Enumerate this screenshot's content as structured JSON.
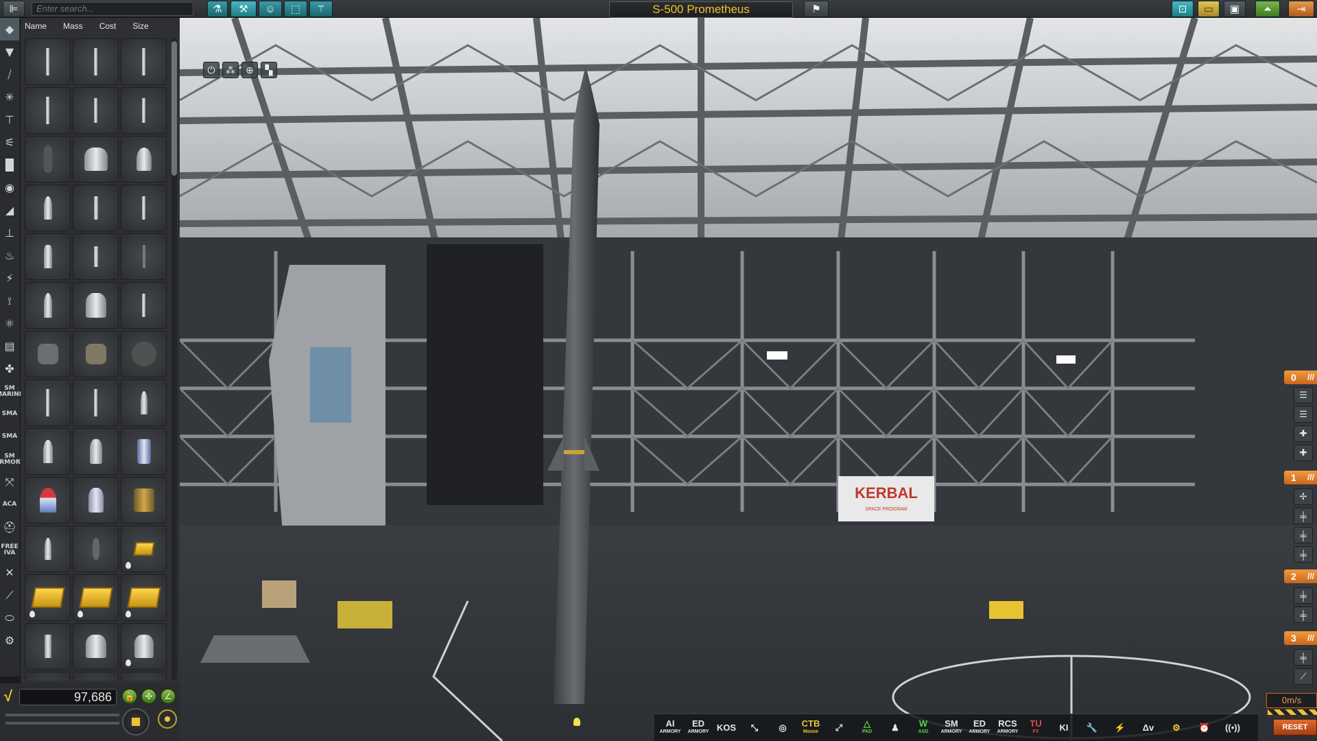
{
  "search": {
    "placeholder": "Enter search..."
  },
  "ship": {
    "name": "S-500 Prometheus"
  },
  "parts_panel": {
    "sort_headers": [
      "Name",
      "Mass",
      "Cost",
      "Size"
    ]
  },
  "funds": {
    "value": "97,686"
  },
  "category_labels": {
    "sm_marine": "SM\nMARINE",
    "sm_armory": "SM\nARMORY",
    "free_iva": "FREE\nIVA",
    "aca": "ACA"
  },
  "staging": {
    "stages": [
      "0",
      "1",
      "2",
      "3"
    ],
    "speed": "0m/s",
    "reset_label": "RESET"
  },
  "toolbar": {
    "items": [
      {
        "label": "AI",
        "sub": "ARMORY"
      },
      {
        "label": "ED",
        "sub": "ARMORY"
      },
      {
        "label": "KOS",
        "sub": ""
      },
      {
        "label": "⤡",
        "sub": ""
      },
      {
        "label": "◎",
        "sub": ""
      },
      {
        "label": "CTB",
        "sub": "Mouse"
      },
      {
        "label": "⤢",
        "sub": ""
      },
      {
        "label": "△",
        "sub": "PAD"
      },
      {
        "label": "♟",
        "sub": ""
      },
      {
        "label": "W",
        "sub": "ASD"
      },
      {
        "label": "SM",
        "sub": "ARMORY"
      },
      {
        "label": "ED",
        "sub": "ARMORY"
      },
      {
        "label": "RCS",
        "sub": "ARMORY"
      },
      {
        "label": "TU",
        "sub": "FX"
      },
      {
        "label": "KI",
        "sub": ""
      },
      {
        "label": "🔧",
        "sub": ""
      },
      {
        "label": "⚡",
        "sub": ""
      },
      {
        "label": "Δv",
        "sub": ""
      },
      {
        "label": "⚙",
        "sub": ""
      },
      {
        "label": "⏰",
        "sub": ""
      },
      {
        "label": "((•))",
        "sub": ""
      }
    ]
  },
  "scene": {
    "banner": "KERBAL",
    "banner_sub": "SPACE PROGRAM"
  },
  "colors": {
    "accent": "#f1c232",
    "teal": "#2a9aa5",
    "stage_orange": "#e07a2a"
  }
}
